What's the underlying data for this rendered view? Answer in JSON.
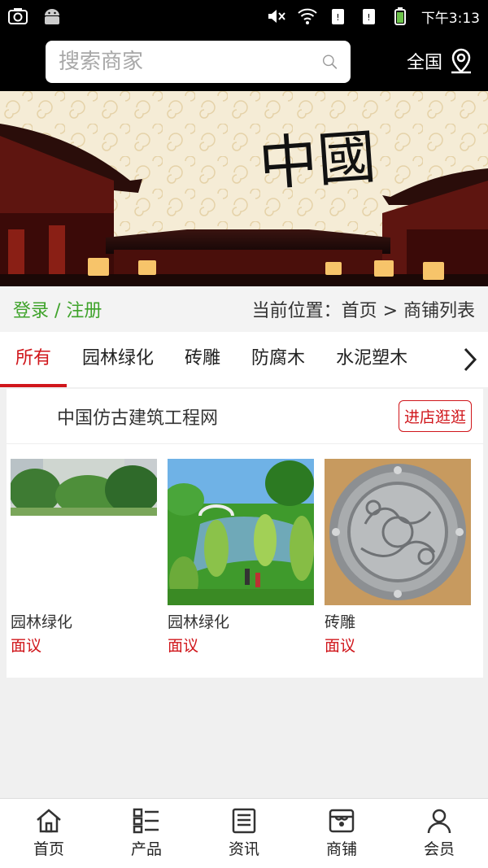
{
  "status": {
    "time": "下午3:13",
    "left_icons": [
      "camera-icon",
      "android-icon"
    ],
    "right_icons": [
      "mute-icon",
      "wifi-icon",
      "sim1-icon",
      "sim2-icon",
      "battery-icon"
    ]
  },
  "header": {
    "search_placeholder": "搜索商家",
    "region_label": "全国"
  },
  "banner": {
    "calligraphy": "中國"
  },
  "breadcrumb": {
    "login_label": "登录 / 注册",
    "location": "当前位置：首页 > 商铺列表"
  },
  "tabs": [
    {
      "label": "所有",
      "active": true
    },
    {
      "label": "园林绿化",
      "active": false
    },
    {
      "label": "砖雕",
      "active": false
    },
    {
      "label": "防腐木",
      "active": false
    },
    {
      "label": "水泥塑木",
      "active": false
    }
  ],
  "shop": {
    "name": "中国仿古建筑工程网",
    "visit_label": "进店逛逛",
    "products": [
      {
        "name": "园林绿化",
        "price": "面议"
      },
      {
        "name": "园林绿化",
        "price": "面议"
      },
      {
        "name": "砖雕",
        "price": "面议"
      }
    ]
  },
  "nav": [
    {
      "label": "首页",
      "icon": "home-icon"
    },
    {
      "label": "产品",
      "icon": "list-icon"
    },
    {
      "label": "资讯",
      "icon": "news-icon"
    },
    {
      "label": "商铺",
      "icon": "store-icon"
    },
    {
      "label": "会员",
      "icon": "user-icon"
    }
  ],
  "colors": {
    "accent": "#d0161b",
    "login_green": "#3fa32b"
  }
}
